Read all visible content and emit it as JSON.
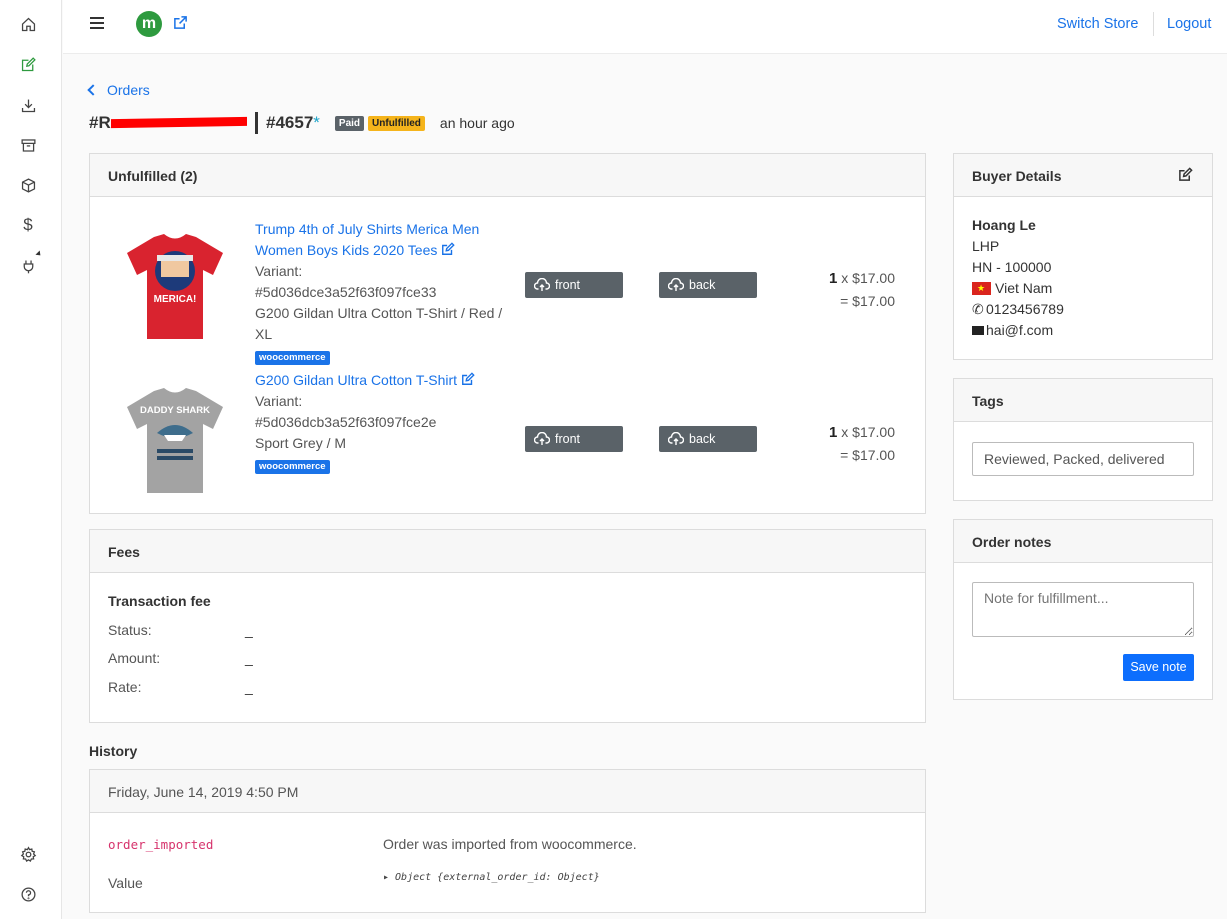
{
  "topbar": {
    "logo_text": "m",
    "switch_store": "Switch Store",
    "logout": "Logout"
  },
  "sidebar": {
    "icons": [
      "home-icon",
      "edit-icon",
      "download-icon",
      "archive-icon",
      "box-icon",
      "dollar-icon",
      "plug-icon",
      "gear-icon",
      "help-icon"
    ],
    "dollar_glyph": "$"
  },
  "header": {
    "back_label": "Orders",
    "ref_prefix": "#R",
    "order_number": "#4657",
    "star": "*",
    "badge_paid": "Paid",
    "badge_unfulfilled": "Unfulfilled",
    "time_ago": "an hour ago"
  },
  "unfulfilled": {
    "title": "Unfulfilled (2)",
    "items": [
      {
        "name": "Trump 4th of July Shirts Merica Men Women Boys Kids 2020 Tees",
        "variant_label": "Variant:",
        "variant_id": "#5d036dce3a52f63f097fce33",
        "variant_desc": "G200 Gildan Ultra Cotton T-Shirt / Red / XL",
        "source": "woocommerce",
        "front": "front",
        "back": "back",
        "qty": "1",
        "price": " x $17.00",
        "total": "= $17.00",
        "shirt_color": "#d9232f",
        "print_text": "MERICA!"
      },
      {
        "name": "G200 Gildan Ultra Cotton T-Shirt",
        "variant_label": "Variant:",
        "variant_id": "#5d036dcb3a52f63f097fce2e",
        "variant_desc": "Sport Grey / M",
        "source": "woocommerce",
        "front": "front",
        "back": "back",
        "qty": "1",
        "price": " x $17.00",
        "total": "= $17.00",
        "shirt_color": "#a3a3a3",
        "print_text": "DADDY SHARK"
      }
    ]
  },
  "fees": {
    "title": "Fees",
    "subtitle": "Transaction fee",
    "rows": [
      {
        "label": "Status:",
        "value": "_"
      },
      {
        "label": "Amount:",
        "value": "_"
      },
      {
        "label": "Rate:",
        "value": "_"
      }
    ]
  },
  "history": {
    "title": "History",
    "date": "Friday, June 14, 2019 4:50 PM",
    "event": "order_imported",
    "event_desc": "Order was imported from woocommerce.",
    "value_label": "Value",
    "value_obj": "▸ Object {external_order_id: Object}"
  },
  "buyer": {
    "title": "Buyer Details",
    "name": "Hoang Le",
    "line1": "LHP",
    "line2": "HN - 100000",
    "country": "Viet Nam",
    "phone": "0123456789",
    "email": "hai@f.com"
  },
  "tags": {
    "title": "Tags",
    "value": "Reviewed, Packed, delivered"
  },
  "notes": {
    "title": "Order notes",
    "placeholder": "Note for fulfillment...",
    "save": "Save note"
  }
}
